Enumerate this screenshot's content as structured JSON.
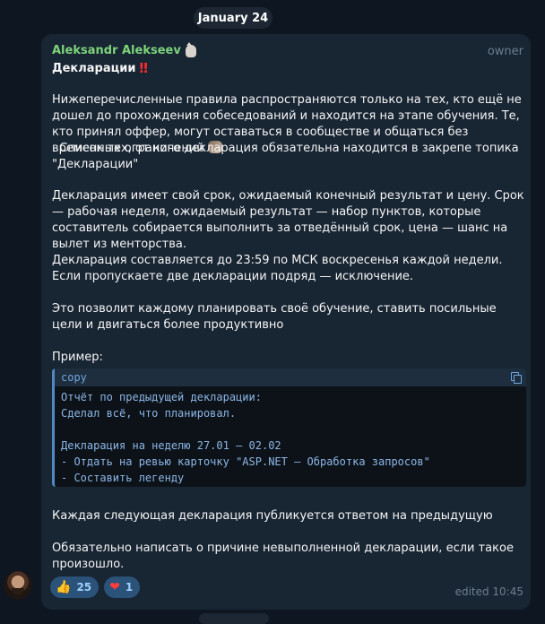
{
  "date_label": "January 24",
  "message": {
    "sender": "Aleksandr Alekseev",
    "role": "owner",
    "title": "Декларации",
    "title_emoji": "‼",
    "paragraphs": [
      "Нижеперечисленные правила распространяются только на тех, кто ещё не дошел до прохождения собеседований и находится на этапе обучения. Те, кто принял оффер, могут оставаться в сообществе и общаться без временных ограничений",
      ". Список тех, от кого декларация обязательна находится в закрепе топика \"Декларации\"",
      "Декларация имеет свой срок, ожидаемый конечный результат и цену. Срок — рабочая неделя, ожидаемый результат — набор пунктов, которые составитель собирается выполнить за отведённый срок, цена — шанс на вылет из менторства.",
      "Декларация составляется до 23:59 по МСК воскресенья каждой недели. Если пропускаете две декларации подряд — исключение.",
      "Это позволит каждому планировать своё обучение, ставить посильные цели и двигаться более продуктивно",
      "Пример:",
      "Каждая следующая декларация публикуется ответом на предыдущую",
      "Обязательно написать о причине невыполненной декларации, если такое произошло."
    ],
    "code": {
      "label": "copy",
      "lines": [
        "Отчёт по предыдущей декларации:",
        "Сделал всё, что планировал.",
        "",
        "Декларация на неделю 27.01 — 02.02",
        "- Отдать на ревью карточку \"ASP.NET — Обработка запросов\"",
        "- Составить легенду"
      ]
    },
    "reactions": [
      {
        "emoji": "👍",
        "count": "25"
      },
      {
        "emoji": "❤",
        "count": "1"
      }
    ],
    "edited_time": "edited 10:45"
  },
  "colors": {
    "background": "#0e1621",
    "bubble": "#182533",
    "sender": "#7dd37b",
    "accent": "#5288c1",
    "reaction": "#2b5278"
  }
}
